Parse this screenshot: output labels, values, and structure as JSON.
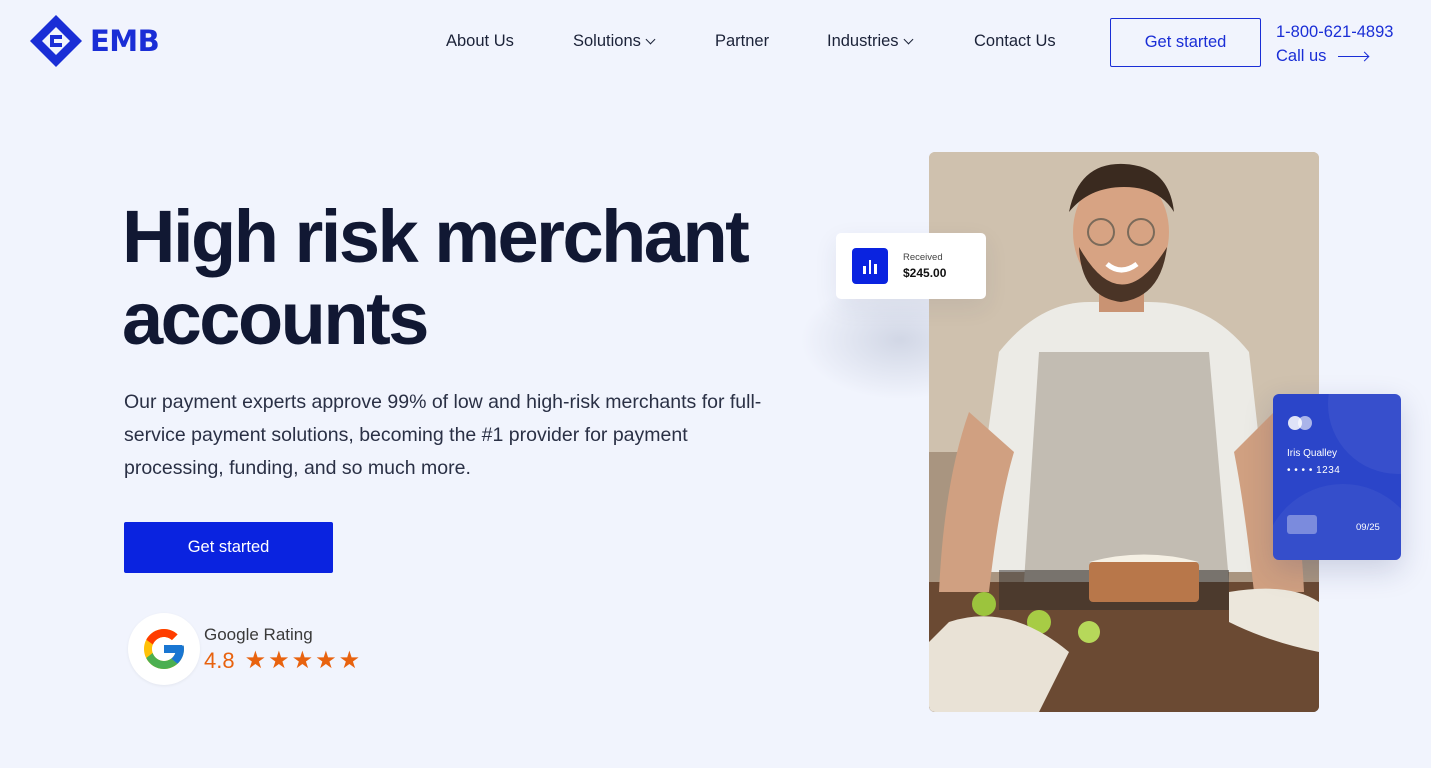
{
  "header": {
    "logo_text": "EMB",
    "nav": [
      {
        "label": "About Us",
        "has_dropdown": false
      },
      {
        "label": "Solutions",
        "has_dropdown": true
      },
      {
        "label": "Partner",
        "has_dropdown": false
      },
      {
        "label": "Industries",
        "has_dropdown": true
      },
      {
        "label": "Contact Us",
        "has_dropdown": false
      }
    ],
    "cta_label": "Get started",
    "phone": "1-800-621-4893",
    "call_label": "Call us"
  },
  "hero": {
    "title_line1": "High risk merchant",
    "title_line2": "accounts",
    "subtitle": "Our payment experts approve 99% of low and high-risk merchants for full-service payment solutions, becoming the #1 provider for payment processing, funding, and so much more.",
    "cta_label": "Get started"
  },
  "rating": {
    "label": "Google Rating",
    "score": "4.8",
    "stars": 5
  },
  "received_widget": {
    "label": "Received",
    "amount": "$245.00"
  },
  "card_widget": {
    "name": "Iris Qualley",
    "number": "• • • •  1234",
    "expiry": "09/25"
  },
  "colors": {
    "brand": "#0a23e0",
    "accent_orange": "#e8620e",
    "background": "#f1f4fd",
    "text_dark": "#111833"
  },
  "icons": [
    "emb-logo-icon",
    "chevron-down-icon",
    "arrow-right-icon",
    "google-g-icon",
    "star-icon",
    "bar-chart-icon",
    "card-brand-icon"
  ]
}
